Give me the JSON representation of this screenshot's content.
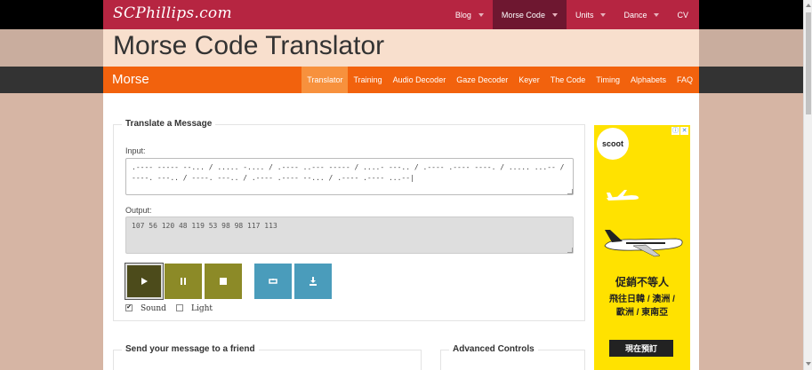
{
  "site": {
    "logo": "SCPhillips.com"
  },
  "topnav": [
    {
      "label": "Blog",
      "dropdown": true,
      "active": false
    },
    {
      "label": "Morse Code",
      "dropdown": true,
      "active": true
    },
    {
      "label": "Units",
      "dropdown": true,
      "active": false
    },
    {
      "label": "Dance",
      "dropdown": true,
      "active": false
    },
    {
      "label": "CV",
      "dropdown": false,
      "active": false
    }
  ],
  "page": {
    "title": "Morse Code Translator"
  },
  "subnav": {
    "section": "Morse",
    "items": [
      {
        "label": "Translator",
        "active": true
      },
      {
        "label": "Training",
        "active": false
      },
      {
        "label": "Audio Decoder",
        "active": false
      },
      {
        "label": "Gaze Decoder",
        "active": false
      },
      {
        "label": "Keyer",
        "active": false
      },
      {
        "label": "The Code",
        "active": false
      },
      {
        "label": "Timing",
        "active": false
      },
      {
        "label": "Alphabets",
        "active": false
      },
      {
        "label": "FAQ",
        "active": false
      }
    ]
  },
  "translate": {
    "legend": "Translate a Message",
    "input_label": "Input:",
    "input_value": ".---- ----- --... / ..... -.... / .---- ..--- ----- / ....- ---.. / .---- .---- ----. / ..... ...-- / ----. ---.. / ----. ---.. / .---- .---- --... / .---- .---- ...--|",
    "output_label": "Output:",
    "output_value": "107 56 120 48 119 53 98 98 117 113",
    "buttons": [
      {
        "name": "play-button",
        "icon": "play-icon"
      },
      {
        "name": "pause-button",
        "icon": "pause-icon"
      },
      {
        "name": "stop-button",
        "icon": "stop-icon"
      },
      {
        "name": "loop-button",
        "icon": "repeat-icon"
      },
      {
        "name": "download-button",
        "icon": "download-icon"
      }
    ],
    "sound_label": "Sound",
    "sound_checked": true,
    "light_label": "Light",
    "light_checked": false
  },
  "send": {
    "legend": "Send your message to a friend"
  },
  "advanced": {
    "legend": "Advanced Controls"
  },
  "ad": {
    "brand": "scoot",
    "headline": "促銷不等人",
    "line1": "飛往日韓 / 澳洲 /",
    "line2": "歐洲 / 東南亞",
    "cta": "現在預訂"
  },
  "colors": {
    "topbar": "#b62541",
    "topbar_active": "#6e1730",
    "title_band": "#f8dfcd",
    "subnav": "#f2620d",
    "subnav_active": "#f7913d",
    "olive_button": "#8c8a27",
    "blue_button": "#4a9cbb",
    "ad_yellow": "#ffe200"
  }
}
